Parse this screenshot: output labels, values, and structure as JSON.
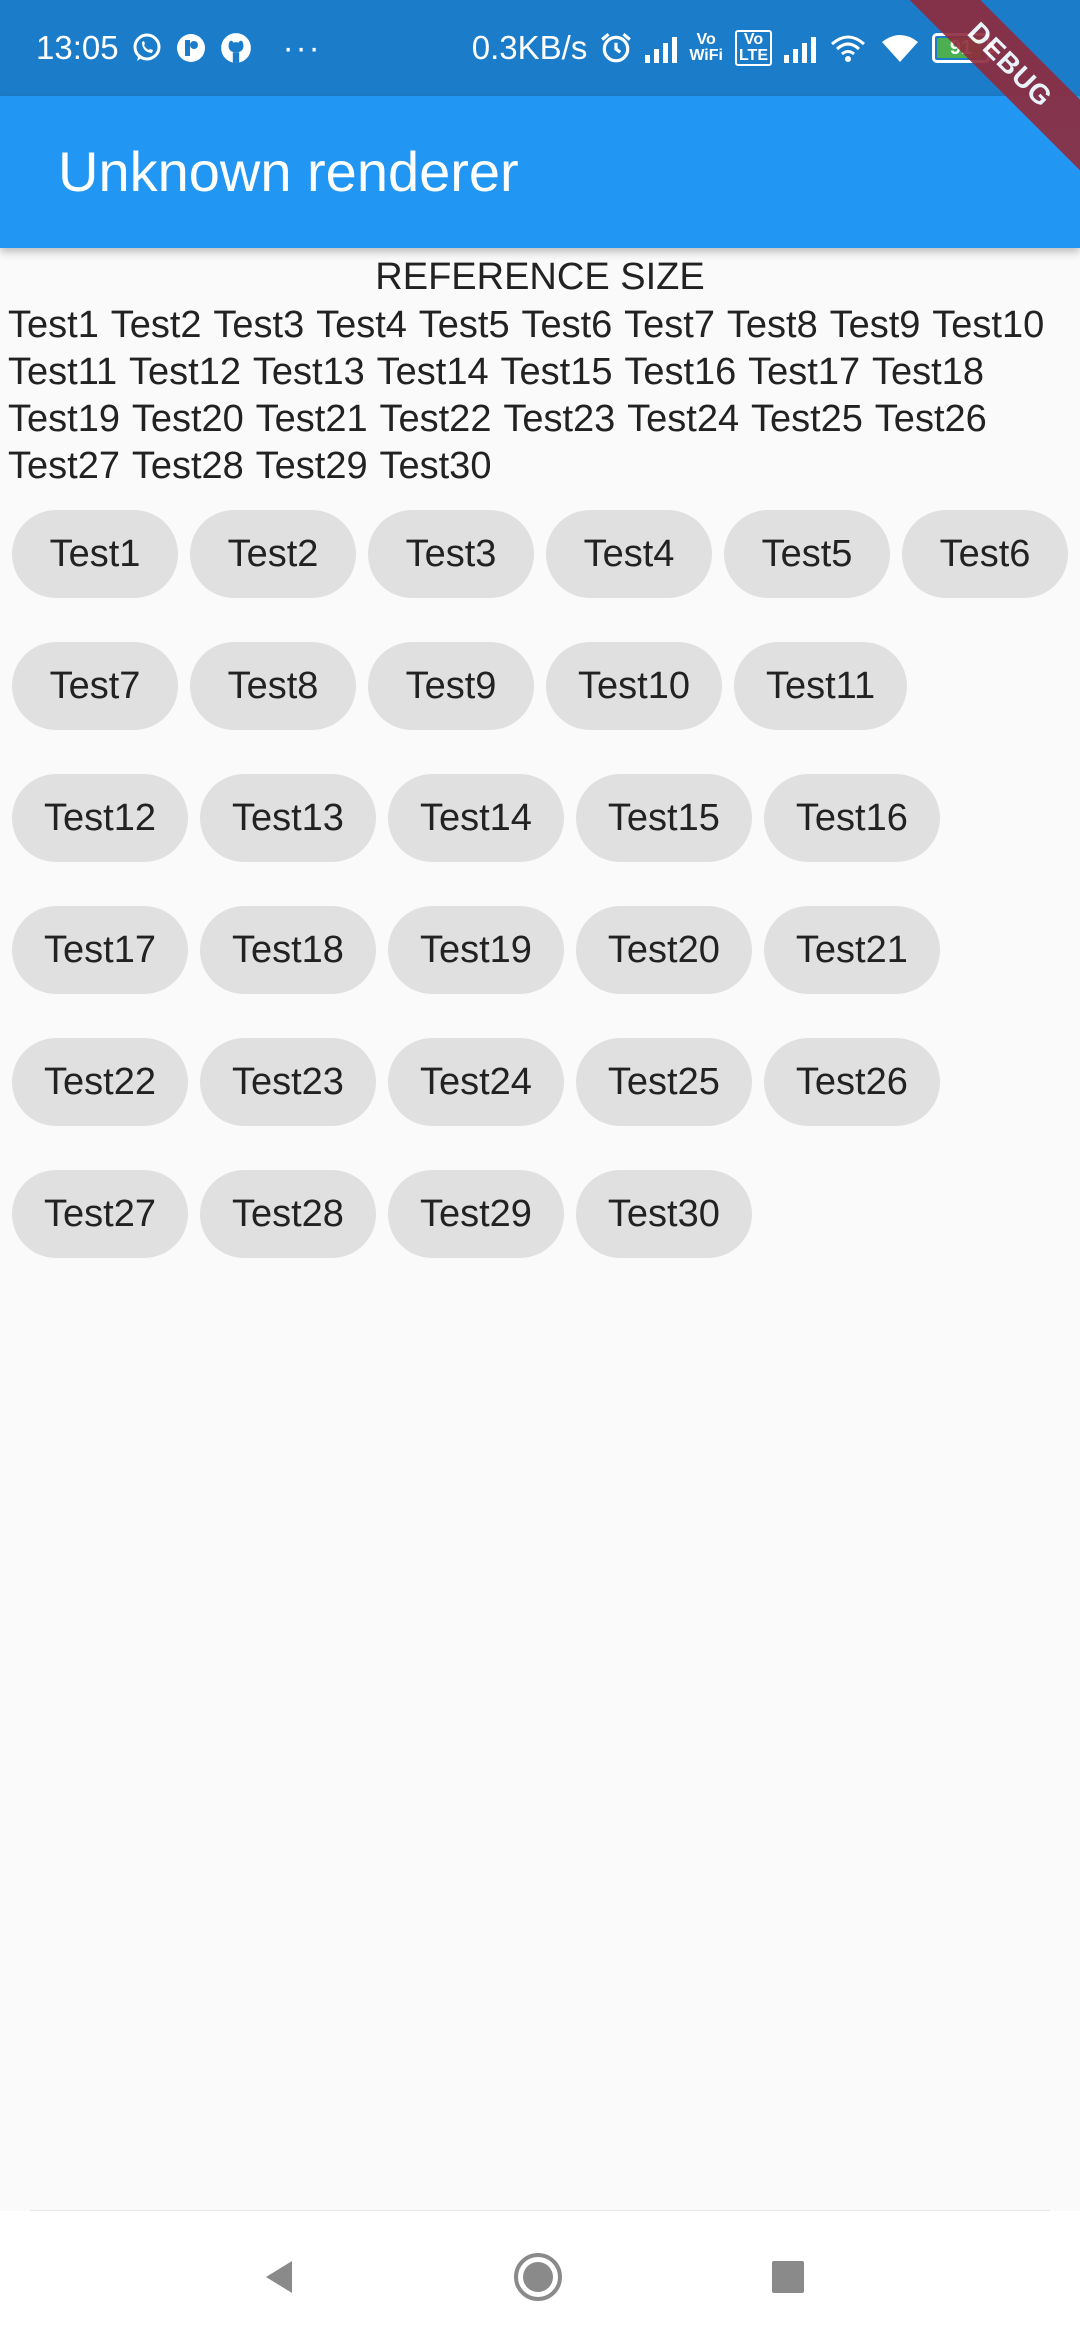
{
  "status_bar": {
    "time": "13:05",
    "more": "···",
    "net_speed": "0.3KB/s",
    "vowifi_top": "Vo",
    "vowifi_bottom": "WiFi",
    "volte_top": "Vo",
    "volte_bottom": "LTE",
    "battery": "91",
    "icons": [
      "whatsapp-icon",
      "app-icon",
      "github-icon",
      "alarm-icon",
      "signal-icon",
      "wifi-icon",
      "battery-icon",
      "charging-icon"
    ]
  },
  "debug_banner": "DEBUG",
  "app_bar": {
    "title": "Unknown renderer",
    "color": "#2196f3"
  },
  "reference": {
    "title": "REFERENCE SIZE",
    "text": "Test1 Test2 Test3 Test4 Test5 Test6 Test7 Test8 Test9 Test10 Test11 Test12 Test13 Test14 Test15 Test16 Test17 Test18 Test19 Test20 Test21 Test22 Test23 Test24 Test25 Test26 Test27 Test28 Test29 Test30"
  },
  "chips": [
    "Test1",
    "Test2",
    "Test3",
    "Test4",
    "Test5",
    "Test6",
    "Test7",
    "Test8",
    "Test9",
    "Test10",
    "Test11",
    "Test12",
    "Test13",
    "Test14",
    "Test15",
    "Test16",
    "Test17",
    "Test18",
    "Test19",
    "Test20",
    "Test21",
    "Test22",
    "Test23",
    "Test24",
    "Test25",
    "Test26",
    "Test27",
    "Test28",
    "Test29",
    "Test30"
  ],
  "nav_bar": {
    "buttons": [
      "back-icon",
      "home-icon",
      "recents-icon"
    ]
  }
}
